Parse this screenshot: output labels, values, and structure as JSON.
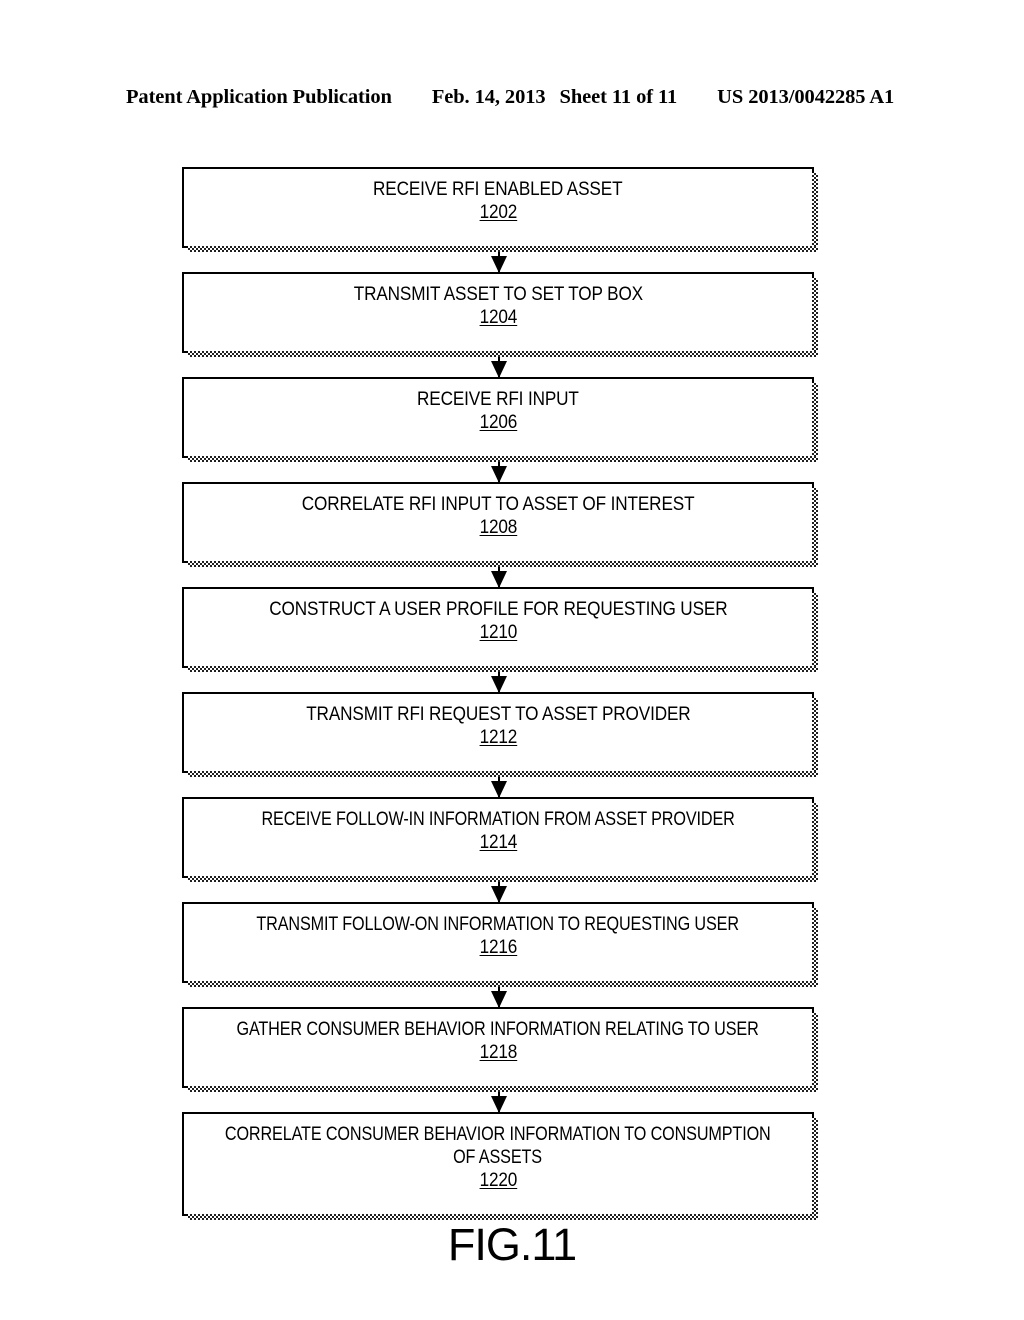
{
  "header": {
    "publication": "Patent Application Publication",
    "date": "Feb. 14, 2013",
    "sheet": "Sheet 11 of 11",
    "patent_number": "US 2013/0042285 A1"
  },
  "figure": {
    "caption": "FIG.11"
  },
  "chart_data": {
    "type": "diagram",
    "diagram_type": "flowchart",
    "orientation": "vertical",
    "title": "FIG.11",
    "node_count": 10,
    "connector": "downward-arrow",
    "nodes": [
      {
        "id": "1202",
        "text": [
          "RECEIVE RFI ENABLED ASSET"
        ],
        "ref": "1202"
      },
      {
        "id": "1204",
        "text": [
          "TRANSMIT ASSET TO SET TOP BOX"
        ],
        "ref": "1204"
      },
      {
        "id": "1206",
        "text": [
          "RECEIVE RFI INPUT"
        ],
        "ref": "1206"
      },
      {
        "id": "1208",
        "text": [
          "CORRELATE RFI INPUT TO ASSET OF INTEREST"
        ],
        "ref": "1208"
      },
      {
        "id": "1210",
        "text": [
          "CONSTRUCT A USER PROFILE FOR REQUESTING USER"
        ],
        "ref": "1210"
      },
      {
        "id": "1212",
        "text": [
          "TRANSMIT RFI REQUEST TO ASSET PROVIDER"
        ],
        "ref": "1212"
      },
      {
        "id": "1214",
        "text": [
          "RECEIVE FOLLOW-IN INFORMATION FROM ASSET PROVIDER"
        ],
        "ref": "1214"
      },
      {
        "id": "1216",
        "text": [
          "TRANSMIT FOLLOW-ON INFORMATION TO REQUESTING USER"
        ],
        "ref": "1216"
      },
      {
        "id": "1218",
        "text": [
          "GATHER CONSUMER BEHAVIOR INFORMATION RELATING TO USER"
        ],
        "ref": "1218"
      },
      {
        "id": "1220",
        "text": [
          "CORRELATE CONSUMER BEHAVIOR INFORMATION TO CONSUMPTION",
          "OF ASSETS"
        ],
        "ref": "1220"
      }
    ],
    "edges": [
      {
        "from": "1202",
        "to": "1204"
      },
      {
        "from": "1204",
        "to": "1206"
      },
      {
        "from": "1206",
        "to": "1208"
      },
      {
        "from": "1208",
        "to": "1210"
      },
      {
        "from": "1210",
        "to": "1212"
      },
      {
        "from": "1212",
        "to": "1214"
      },
      {
        "from": "1214",
        "to": "1216"
      },
      {
        "from": "1216",
        "to": "1218"
      },
      {
        "from": "1218",
        "to": "1220"
      }
    ]
  },
  "colors": {
    "ink": "#000000",
    "paper": "#ffffff"
  }
}
